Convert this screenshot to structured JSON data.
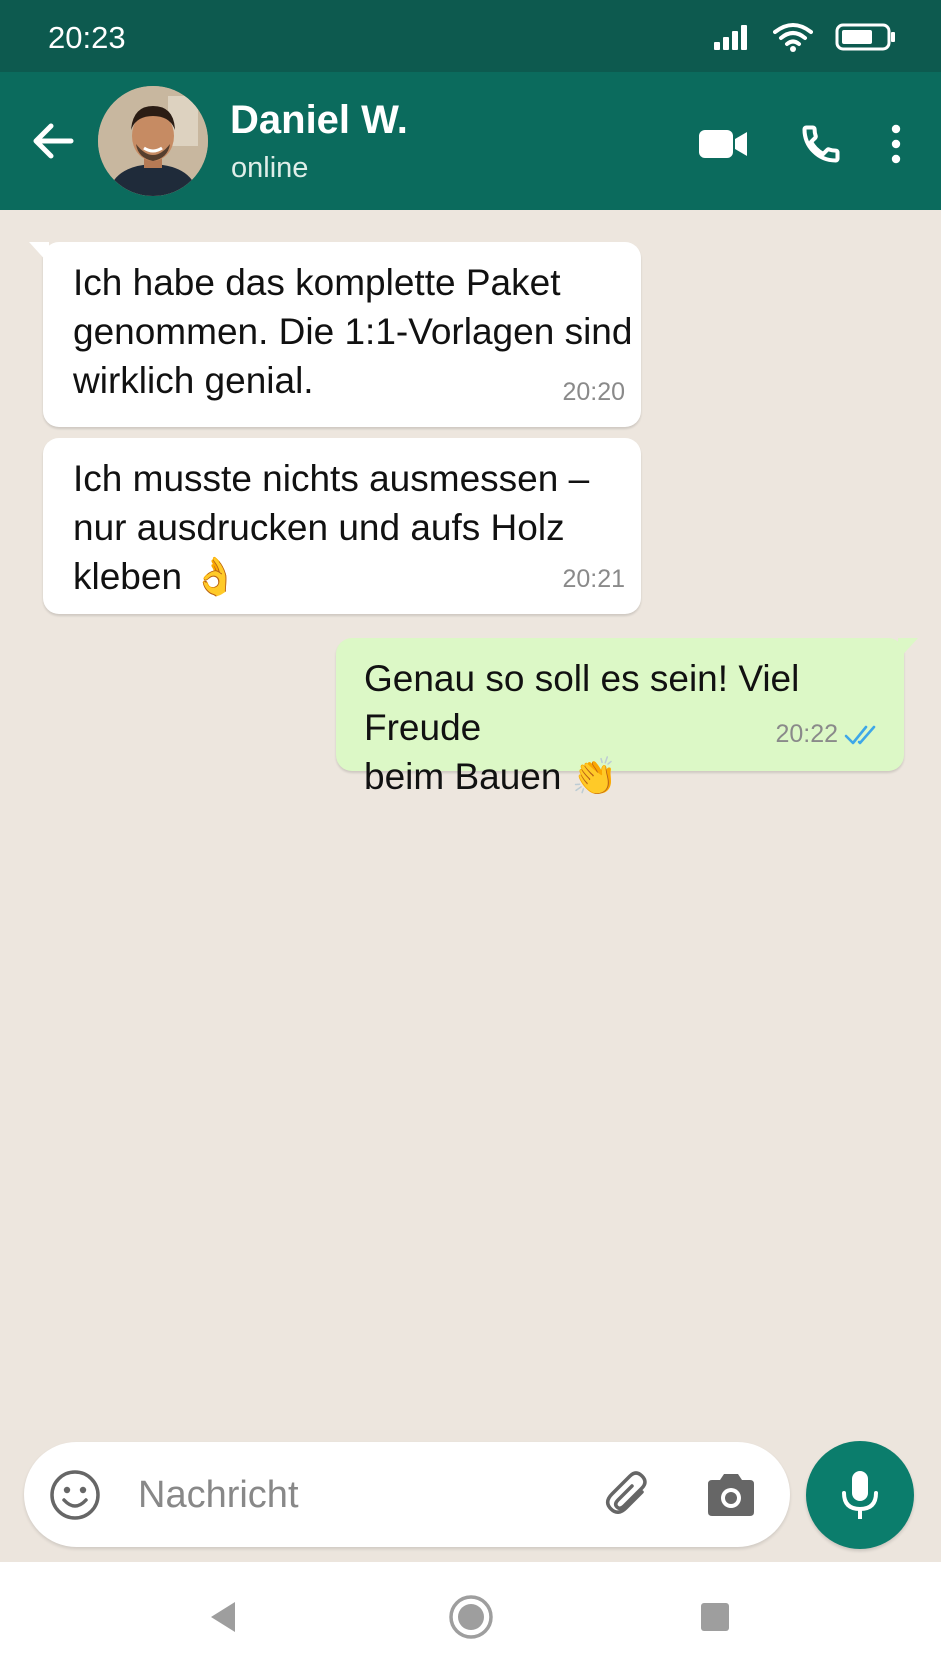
{
  "status_bar": {
    "time": "20:23",
    "icons": [
      "signal-icon",
      "wifi-icon",
      "battery-icon"
    ]
  },
  "header": {
    "back_icon": "arrow-left-icon",
    "contact_name": "Daniel W.",
    "contact_status": "online",
    "actions": [
      "video-call-icon",
      "voice-call-icon",
      "more-vert-icon"
    ],
    "color": "#0b6b5d"
  },
  "messages": [
    {
      "direction": "incoming",
      "text": "Ich habe das komplette Paket\ngenommen. Die 1:1-Vorlagen sind\nwirklich genial.",
      "time": "20:20"
    },
    {
      "direction": "incoming",
      "text": "Ich musste nichts ausmessen –\nnur ausdrucken und aufs Holz\nkleben 👌",
      "time": "20:21"
    },
    {
      "direction": "outgoing",
      "text": "Genau so soll es sein! Viel Freude\nbeim Bauen 👏",
      "time": "20:22",
      "read": true
    }
  ],
  "composer": {
    "placeholder": "Nachricht",
    "value": "",
    "icons": [
      "emoji-icon",
      "paperclip-icon",
      "camera-icon",
      "microphone-icon"
    ]
  },
  "navigation": [
    "back-triangle-icon",
    "home-circle-icon",
    "recents-square-icon"
  ],
  "colors": {
    "chat_background": "#ede6de",
    "incoming_bubble": "#ffffff",
    "outgoing_bubble": "#dcf8c6",
    "accent": "#0b7d6c",
    "read_ticks": "#3ea7e8"
  }
}
